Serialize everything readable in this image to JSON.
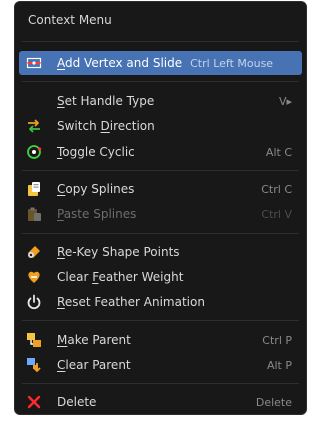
{
  "menu": {
    "title": "Context Menu",
    "colors": {
      "background": "#181818",
      "highlight": "#4772b3",
      "text": "#d9d9d9",
      "shortcut": "#8a8a8a"
    },
    "items": [
      {
        "first": "A",
        "rest": "dd Vertex and Slide",
        "shortcut": "Ctrl Left Mouse",
        "icon": "add-vertex-slide-icon"
      },
      {
        "first": "S",
        "rest": "et Handle Type",
        "shortcut": "V▸",
        "icon": ""
      },
      {
        "first": "Switch ",
        "u": "D",
        "rest": "irection",
        "shortcut": "",
        "icon": "switch-direction-icon"
      },
      {
        "first": "T",
        "rest": "oggle Cyclic",
        "shortcut": "Alt C",
        "icon": "toggle-cyclic-icon"
      },
      {
        "first": "C",
        "rest": "opy Splines",
        "shortcut": "Ctrl C",
        "icon": "copy-icon"
      },
      {
        "first": "P",
        "rest": "aste Splines",
        "shortcut": "Ctrl V",
        "icon": "paste-icon"
      },
      {
        "first": "R",
        "rest": "e-Key Shape Points",
        "shortcut": "",
        "icon": "shape-key-icon"
      },
      {
        "first": "Clear ",
        "u": "F",
        "rest": "eather Weight",
        "shortcut": "",
        "icon": "clear-feather-weight-icon"
      },
      {
        "first": "R",
        "rest": "eset Feather Animation",
        "shortcut": "",
        "icon": "power-icon"
      },
      {
        "first": "M",
        "rest": "ake Parent",
        "shortcut": "Ctrl P",
        "icon": "make-parent-icon"
      },
      {
        "first": "C",
        "rest": "lear Parent",
        "shortcut": "Alt P",
        "icon": "clear-parent-icon"
      },
      {
        "first": "Delete",
        "rest": "",
        "shortcut": "Delete",
        "icon": "delete-icon"
      }
    ]
  }
}
